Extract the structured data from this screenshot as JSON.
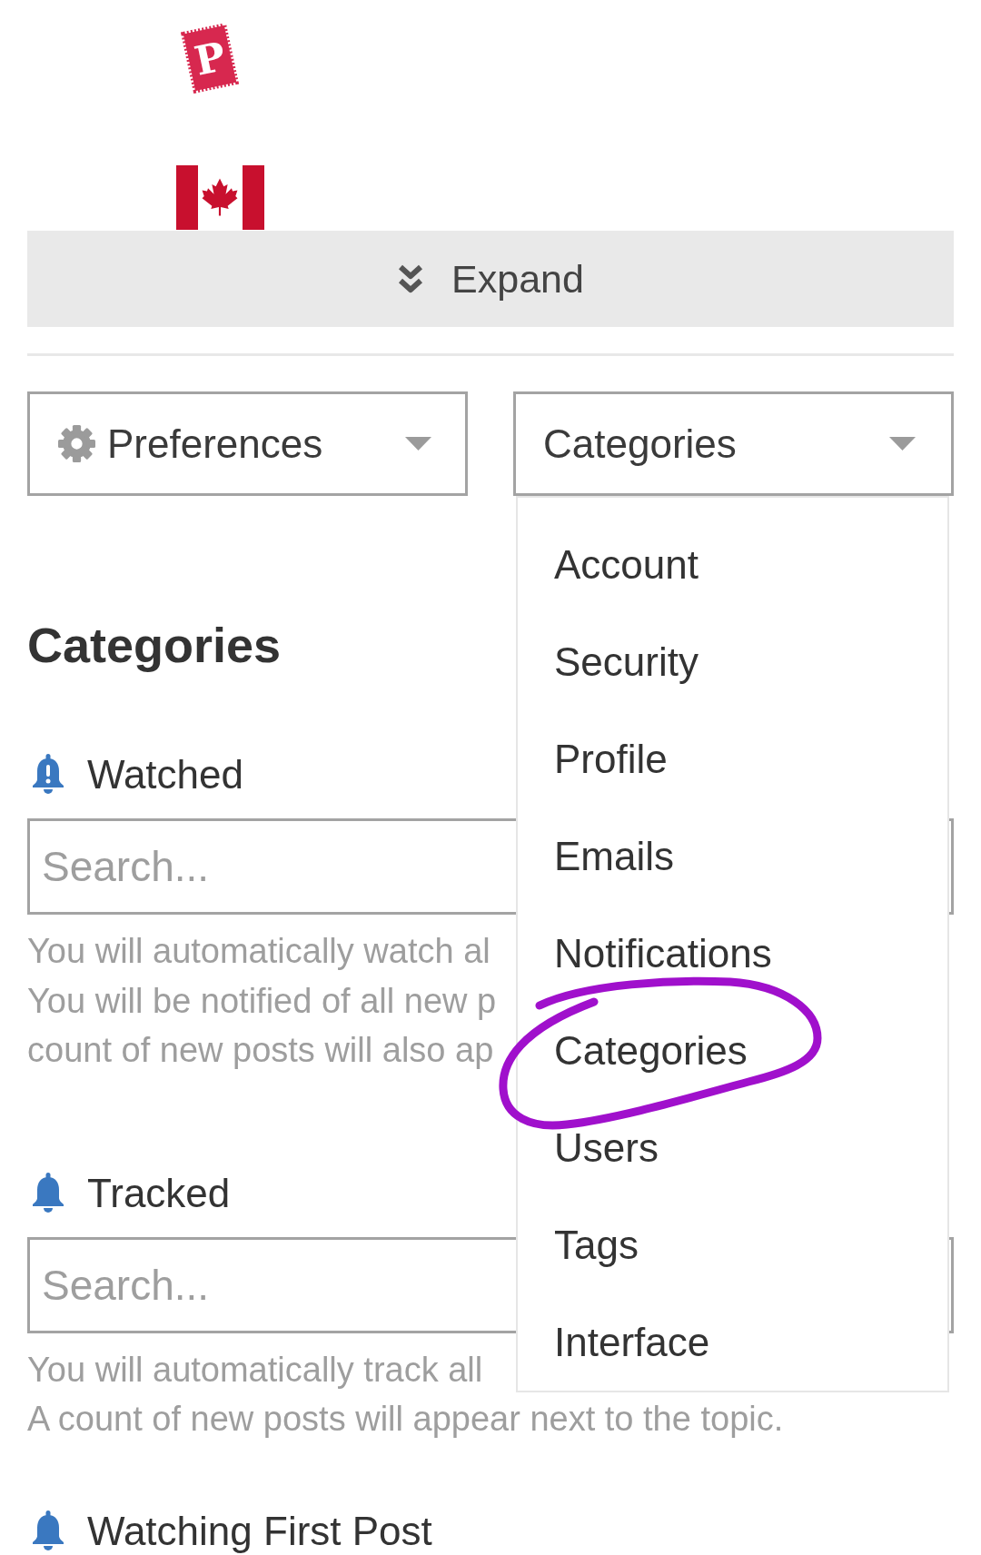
{
  "logo": {
    "letter": "P"
  },
  "expand_bar": {
    "label": "Expand"
  },
  "dropdowns": [
    {
      "kind": "icon",
      "label": "Preferences",
      "expanded": false
    },
    {
      "kind": "plain",
      "label": "Categories",
      "expanded": true,
      "menu": [
        {
          "label": "Account",
          "circled": false
        },
        {
          "label": "Security",
          "circled": false
        },
        {
          "label": "Profile",
          "circled": false
        },
        {
          "label": "Emails",
          "circled": false
        },
        {
          "label": "Notifications",
          "circled": false
        },
        {
          "label": "Categories",
          "circled": true
        },
        {
          "label": "Users",
          "circled": false
        },
        {
          "label": "Tags",
          "circled": false
        },
        {
          "label": "Interface",
          "circled": false
        }
      ]
    }
  ],
  "heading": "Categories",
  "sections": [
    {
      "kind": "watched",
      "title": "Watched",
      "search": {
        "placeholder": "Search..."
      },
      "description_lines": [
        "You will automatically watch al",
        "You will be notified of all new p",
        "count of new posts will also ap"
      ]
    },
    {
      "kind": "tracked",
      "title": "Tracked",
      "search": {
        "placeholder": "Search..."
      },
      "description_lines": [
        "You will automatically track all",
        "A count of new posts will appear next to the topic."
      ]
    },
    {
      "kind": "watching_first_post",
      "title": "Watching First Post"
    }
  ]
}
